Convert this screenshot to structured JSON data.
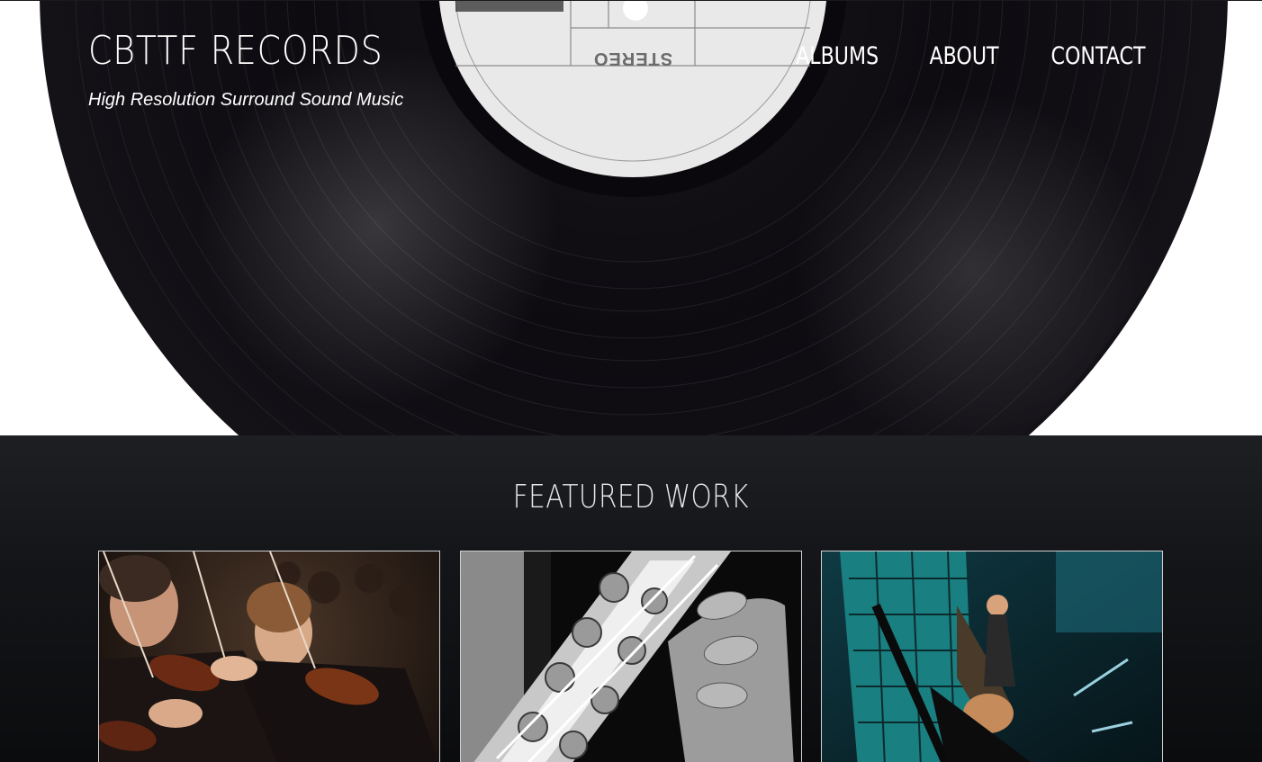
{
  "site": {
    "title": "CBTTF RECORDS",
    "tagline": "High Resolution Surround Sound Music"
  },
  "nav": {
    "items": [
      {
        "label": "ALBUMS"
      },
      {
        "label": "ABOUT"
      },
      {
        "label": "CONTACT"
      }
    ]
  },
  "hero": {
    "record_label_text": "STEREO"
  },
  "featured": {
    "heading": "FEATURED WORK",
    "cards": [
      {
        "image": "violin-orchestra-photo"
      },
      {
        "image": "saxophone-photo"
      },
      {
        "image": "guitarist-on-stage-photo"
      }
    ]
  },
  "colors": {
    "hero_bg": "#ffffff",
    "vinyl": "#0d0b10",
    "label": "#e9e9e9",
    "section_bg": "#131518",
    "text": "#ffffff"
  }
}
